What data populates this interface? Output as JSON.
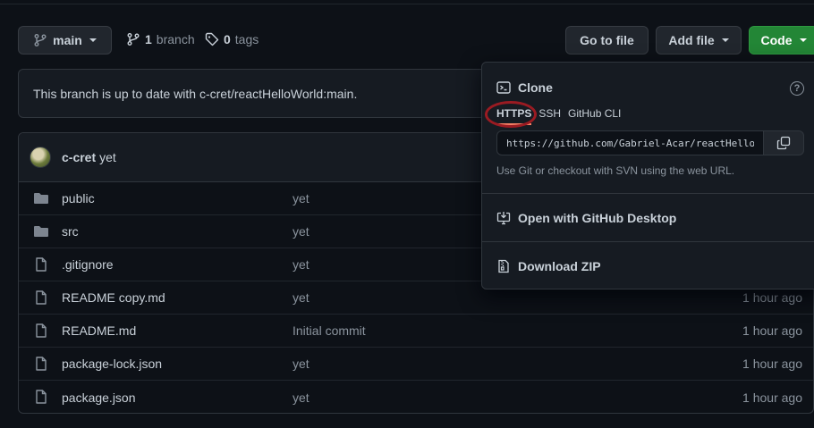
{
  "toolbar": {
    "branch_label": "main",
    "branch_count": "1",
    "branch_word": "branch",
    "tag_count": "0",
    "tag_word": "tags",
    "goto_label": "Go to file",
    "addfile_label": "Add file",
    "code_label": "Code"
  },
  "banner": {
    "text": "This branch is up to date with c-cret/reactHelloWorld:main."
  },
  "commit": {
    "author": "c-cret",
    "message": "yet"
  },
  "files": [
    {
      "name": "public",
      "type": "folder",
      "message": "yet",
      "age": ""
    },
    {
      "name": "src",
      "type": "folder",
      "message": "yet",
      "age": ""
    },
    {
      "name": ".gitignore",
      "type": "file",
      "message": "yet",
      "age": ""
    },
    {
      "name": "README copy.md",
      "type": "file",
      "message": "yet",
      "age": "1 hour ago"
    },
    {
      "name": "README.md",
      "type": "file",
      "message": "Initial commit",
      "age": "1 hour ago"
    },
    {
      "name": "package-lock.json",
      "type": "file",
      "message": "yet",
      "age": "1 hour ago"
    },
    {
      "name": "package.json",
      "type": "file",
      "message": "yet",
      "age": "1 hour ago"
    }
  ],
  "clone": {
    "title": "Clone",
    "tabs": [
      "HTTPS",
      "SSH",
      "GitHub CLI"
    ],
    "active_tab": "HTTPS",
    "url": "https://github.com/Gabriel-Acar/reactHelloWorld.git",
    "help": "Use Git or checkout with SVN using the web URL.",
    "desktop_label": "Open with GitHub Desktop",
    "zip_label": "Download ZIP"
  },
  "colors": {
    "background": "#0d1117",
    "accent_green": "#238636",
    "tab_underline": "#f78166",
    "annotation_ring": "#9a1b22"
  }
}
